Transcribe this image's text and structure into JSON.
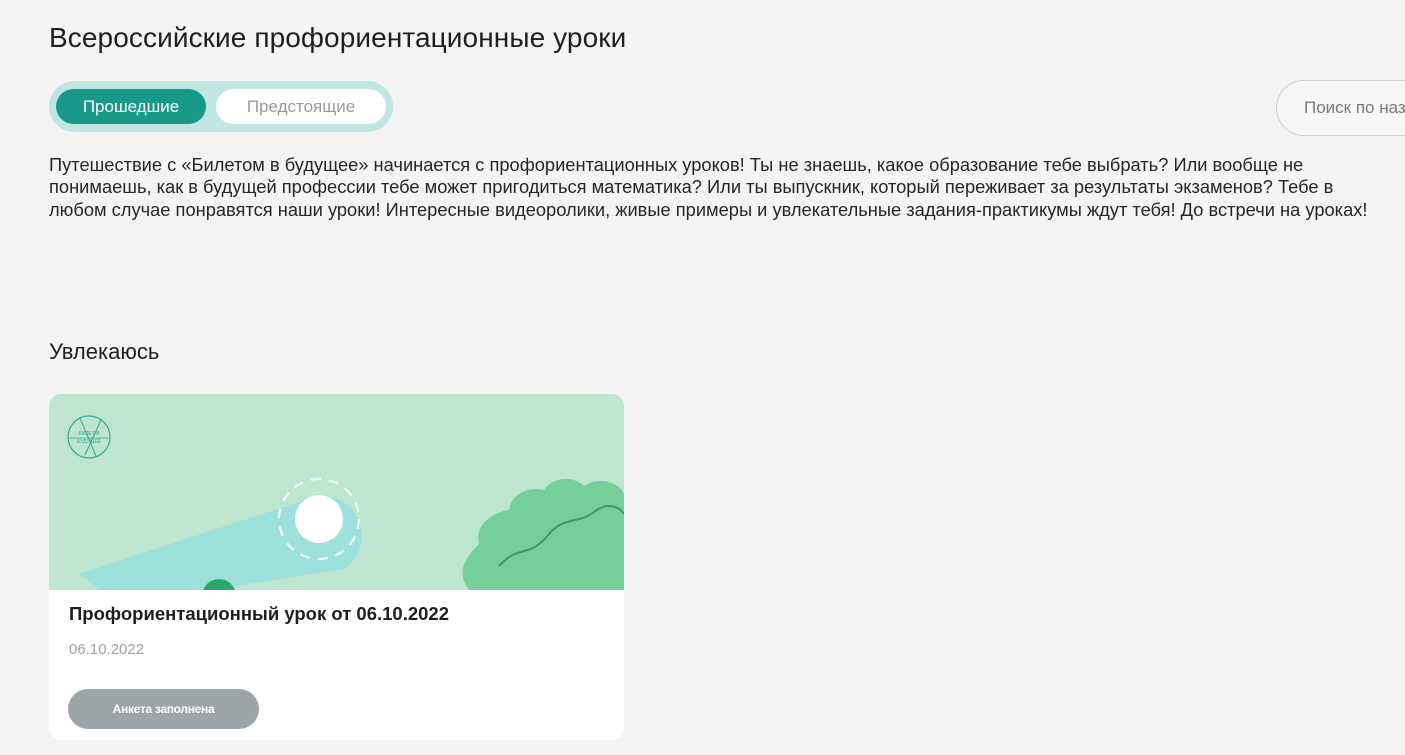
{
  "page": {
    "title": "Всероссийские профориентационные уроки"
  },
  "tabs": [
    {
      "label": "Прошедшие",
      "active": true
    },
    {
      "label": "Предстоящие",
      "active": false
    }
  ],
  "search": {
    "placeholder": "Поиск по названию"
  },
  "intro": {
    "text": "Путешествие с «Билетом в будущее» начинается с профориентационных уроков! Ты не знаешь, какое образование тебе выбрать? Или вообще не понимаешь, как в будущей профессии тебе может пригодиться математика? Или ты выпускник, который переживает за результаты экзаменов? Тебе в любом случае понравятся наши уроки! Интересные видеоролики, живые примеры и увлекательные задания-практикумы ждут тебя! До встречи на уроках!"
  },
  "section": {
    "title": "Увлекаюсь"
  },
  "cards": [
    {
      "title": "Профориентационный урок от 06.10.2022",
      "date": "06.10.2022",
      "badge": "Анкета заполнена",
      "logo_text": "БИЛЕТ В БУДУЩЕЕ"
    }
  ],
  "colors": {
    "accent": "#17988a",
    "tabs_bg": "#bfe6e1",
    "banner_bg": "#bde5cf",
    "badge_bg": "#9ea5a8",
    "page_bg": "#f4f4f4"
  }
}
